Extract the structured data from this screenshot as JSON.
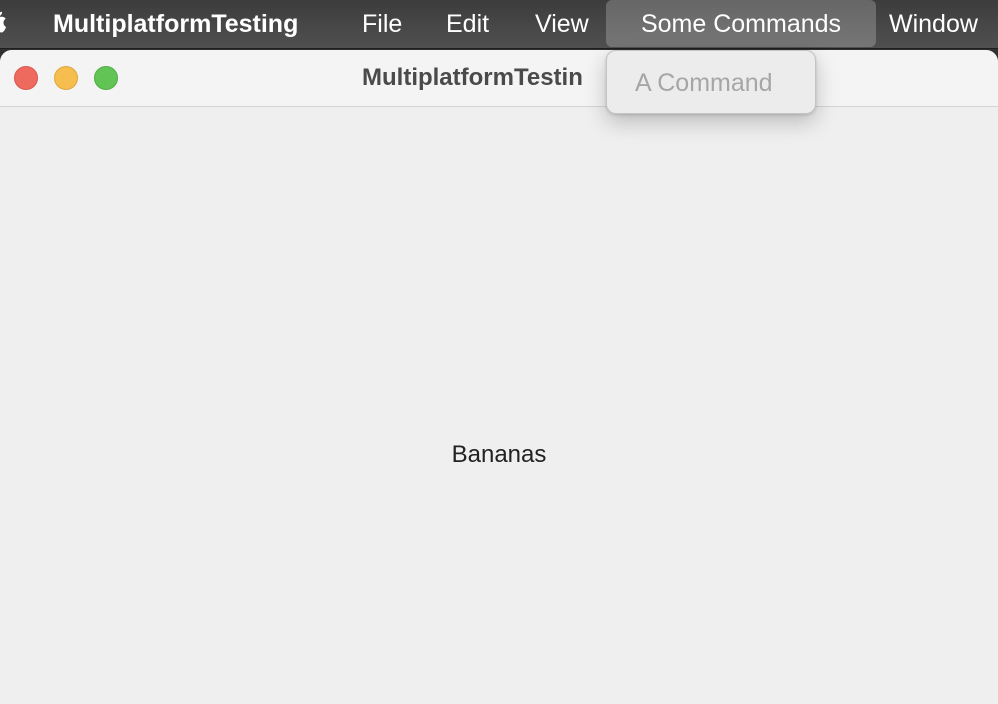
{
  "menubar": {
    "apple_icon": "apple-logo-icon",
    "app_name": "MultiplatformTesting",
    "items": [
      {
        "label": "File"
      },
      {
        "label": "Edit"
      },
      {
        "label": "View"
      },
      {
        "label": "Some Commands",
        "active": true
      },
      {
        "label": "Window"
      }
    ]
  },
  "window": {
    "title": "MultiplatformTestin",
    "controls": {
      "close_color": "#ee6a5f",
      "minimize_color": "#f5be4f",
      "zoom_color": "#61c454"
    },
    "content_text": "Bananas"
  },
  "dropdown": {
    "items": [
      {
        "label": "A Command",
        "enabled": false
      }
    ]
  }
}
